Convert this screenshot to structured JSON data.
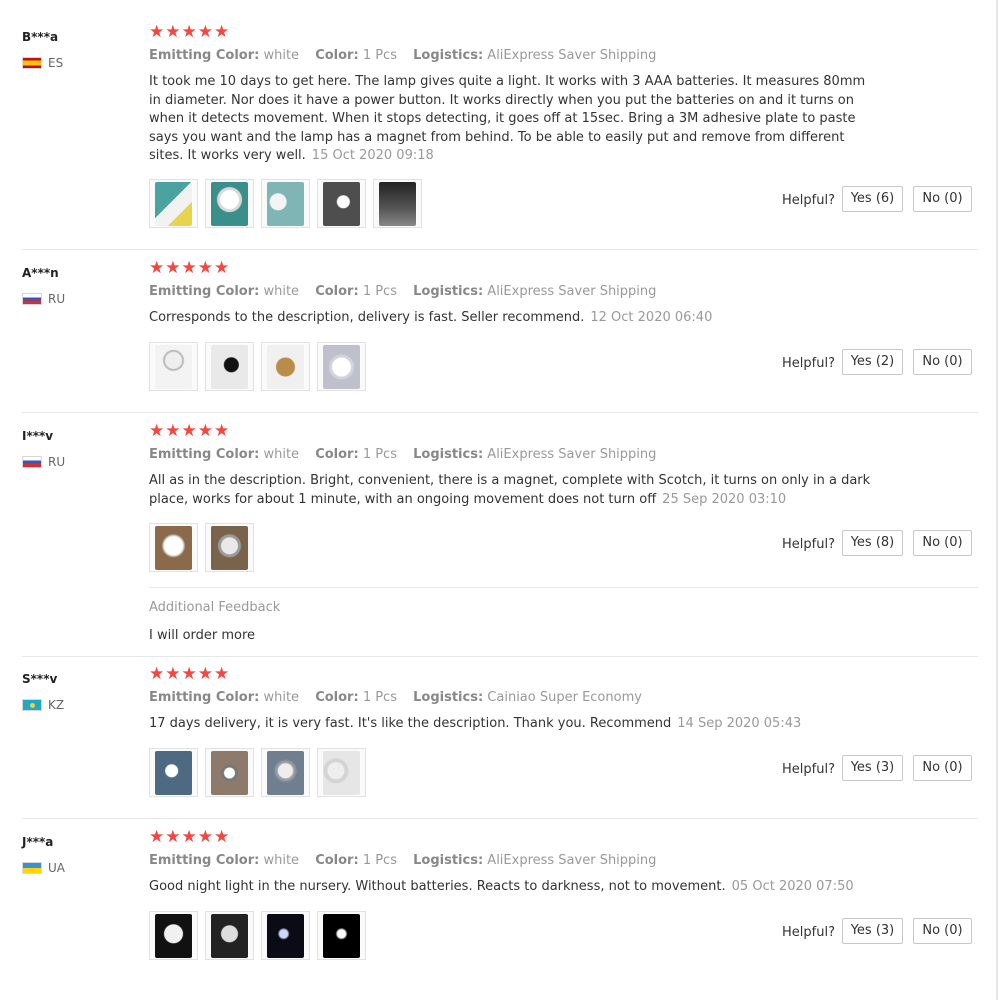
{
  "helpful_label": "Helpful?",
  "rating_stars": "★★★★★",
  "labels": {
    "emitting_color": "Emitting Color:",
    "color": "Color:",
    "logistics": "Logistics:"
  },
  "reviews": [
    {
      "user": "B***a",
      "country": "ES",
      "emitting_color": "white",
      "color": "1 Pcs",
      "logistics": "AliExpress Saver Shipping",
      "text": "It took me 10 days to get here. The lamp gives quite a light. It works with 3 AAA batteries. It measures 80mm in diameter. Nor does it have a power button. It works directly when you put the batteries on and it turns on when it detects movement. When it stops detecting, it goes off at 15sec. Bring a 3M adhesive plate to paste says you want and the lamp has a magnet from behind. To be able to easily put and remove from different sites. It works very well.",
      "date": "15 Oct 2020 09:18",
      "yes": "Yes (6)",
      "no": "No (0)"
    },
    {
      "user": "A***n",
      "country": "RU",
      "emitting_color": "white",
      "color": "1 Pcs",
      "logistics": "AliExpress Saver Shipping",
      "text": "Corresponds to the description, delivery is fast. Seller recommend.",
      "date": "12 Oct 2020 06:40",
      "yes": "Yes (2)",
      "no": "No (0)"
    },
    {
      "user": "I***v",
      "country": "RU",
      "emitting_color": "white",
      "color": "1 Pcs",
      "logistics": "AliExpress Saver Shipping",
      "text": "All as in the description. Bright, convenient, there is a magnet, complete with Scotch, it turns on only in a dark place, works for about 1 minute, with an ongoing movement does not turn off",
      "date": "25 Sep 2020 03:10",
      "yes": "Yes (8)",
      "no": "No (0)",
      "additional_feedback_title": "Additional Feedback",
      "additional_feedback_text": "I will order more"
    },
    {
      "user": "S***v",
      "country": "KZ",
      "emitting_color": "white",
      "color": "1 Pcs",
      "logistics": "Cainiao Super Economy",
      "text": "17 days delivery, it is very fast. It's like the description. Thank you. Recommend",
      "date": "14 Sep 2020 05:43",
      "yes": "Yes (3)",
      "no": "No (0)"
    },
    {
      "user": "J***a",
      "country": "UA",
      "emitting_color": "white",
      "color": "1 Pcs",
      "logistics": "AliExpress Saver Shipping",
      "text": "Good night light in the nursery. Without batteries. Reacts to darkness, not to movement.",
      "date": "05 Oct 2020 07:50",
      "yes": "Yes (3)",
      "no": "No (0)"
    }
  ]
}
